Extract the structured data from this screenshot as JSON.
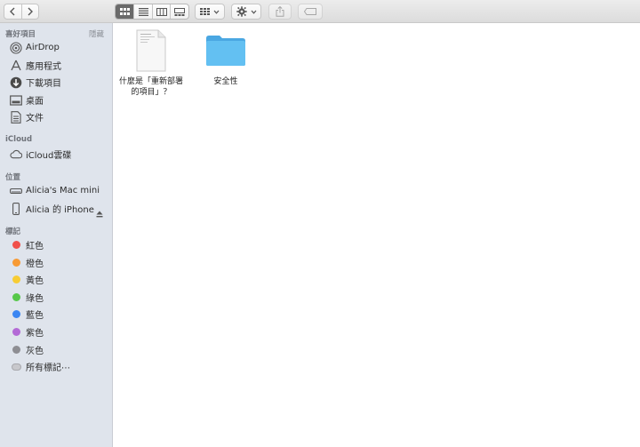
{
  "toolbar": {
    "back_icon": "chevron-left-icon",
    "forward_icon": "chevron-right-icon",
    "view_modes": [
      "icon-view",
      "list-view",
      "column-view",
      "gallery-view"
    ],
    "active_view": "icon-view"
  },
  "sidebar": {
    "favorites_title": "喜好項目",
    "hide_label": "隱藏",
    "favorites": [
      {
        "label": "AirDrop",
        "icon": "airdrop-icon"
      },
      {
        "label": "應用程式",
        "icon": "applications-icon"
      },
      {
        "label": "下載項目",
        "icon": "downloads-icon"
      },
      {
        "label": "桌面",
        "icon": "desktop-icon"
      },
      {
        "label": "文件",
        "icon": "documents-icon"
      }
    ],
    "icloud_title": "iCloud",
    "icloud": [
      {
        "label": "iCloud雲碟",
        "icon": "cloud-icon"
      }
    ],
    "locations_title": "位置",
    "locations": [
      {
        "label": "Alicia's Mac mini",
        "icon": "mac-mini-icon"
      },
      {
        "label": "Alicia 的 iPhone",
        "icon": "iphone-icon"
      }
    ],
    "tags_title": "標記",
    "tags": [
      {
        "label": "紅色",
        "color": "#f0504a"
      },
      {
        "label": "橙色",
        "color": "#f79a34"
      },
      {
        "label": "黃色",
        "color": "#f7cc34"
      },
      {
        "label": "綠色",
        "color": "#57c84a"
      },
      {
        "label": "藍色",
        "color": "#3b86f2"
      },
      {
        "label": "紫色",
        "color": "#b36ad6"
      },
      {
        "label": "灰色",
        "color": "#8e8e93"
      },
      {
        "label": "所有標記⋯",
        "color": "#c8c8cc"
      }
    ]
  },
  "content": {
    "items": [
      {
        "name_line1": "什麼是「重新部署",
        "name_line2": "的項目」？",
        "icon": "document-icon"
      },
      {
        "name_line1": "安全性",
        "name_line2": "",
        "icon": "folder-icon"
      }
    ]
  },
  "colors": {
    "folder": "#5ab8ef",
    "sidebar_bg": "#dfe4ec"
  }
}
